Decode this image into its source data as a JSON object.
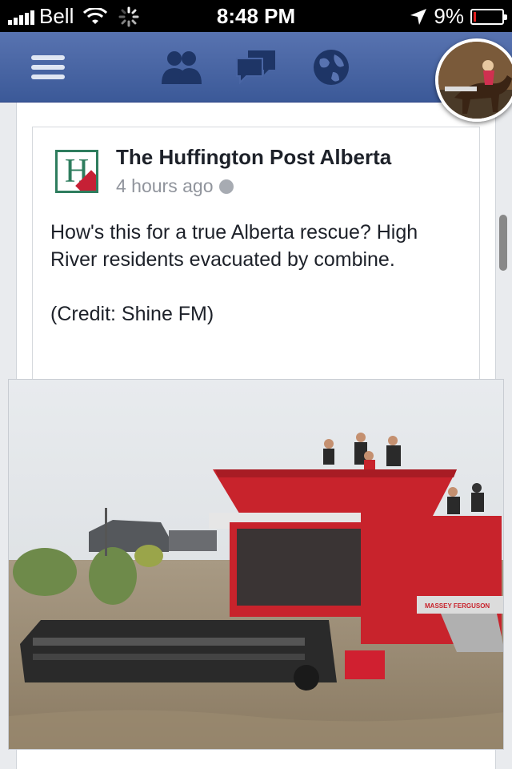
{
  "status_bar": {
    "carrier": "Bell",
    "time": "8:48 PM",
    "battery": "9%",
    "battery_level": 0.09
  },
  "navbar": {
    "icons": [
      "menu-icon",
      "friend-requests-icon",
      "messages-icon",
      "notifications-globe-icon",
      "profile-avatar"
    ]
  },
  "post": {
    "page_name": "The Huffington Post Alberta",
    "logo_letter": "H",
    "time": "4 hours ago",
    "text_lines": [
      "How's this for a true Alberta rescue? High River residents evacuated by combine.",
      "(Credit: Shine FM)"
    ],
    "photo_brand": "MASSEY FERGUSON"
  },
  "colors": {
    "navbar": "#3b5998",
    "background": "#e9ebee",
    "combine_red": "#c8232c",
    "logo_green": "#2e7d5e"
  }
}
